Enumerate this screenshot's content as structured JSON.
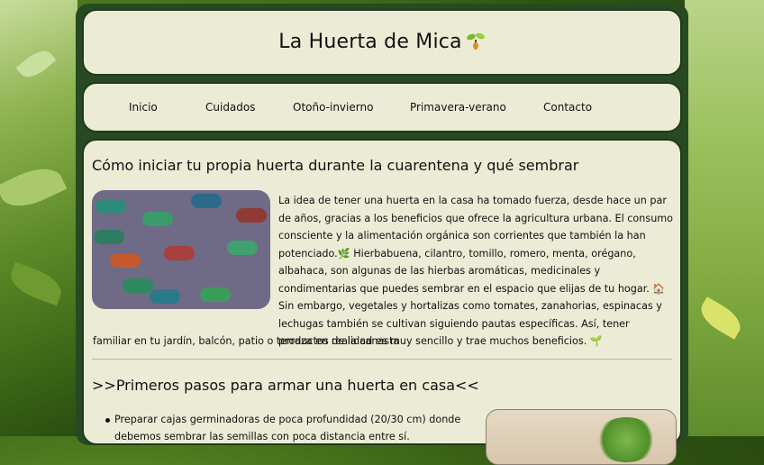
{
  "site": {
    "title": "La Huerta de Mica"
  },
  "nav": {
    "items": [
      "Inicio",
      "Cuidados",
      "Otoño-invierno",
      "Primavera-verano",
      "Contacto"
    ]
  },
  "post": {
    "title": "Cómo iniciar tu propia huerta durante la cuarentena y qué sembrar",
    "p1": "La idea de tener una huerta en la casa ha tomado fuerza, desde hace un par de años, gracias a los beneficios que ofrece la agricultura urbana. El consumo consciente y la alimentación orgánica son corrientes que también la han potenciado.🌿 Hierbabuena, cilantro, tomillo, romero, menta, orégano, albahaca, son algunas de las hierbas aromáticas, medicinales y condimentarias que puedes sembrar en el espacio que elijas de tu hogar. 🏠",
    "p2": "Sin embargo, vegetales y hortalizas como tomates, zanahorias, espinacas y lechugas también se cultivan siguiendo pautas específicas. Así, tener productos de la canasta",
    "p3": "familiar en tu jardín, balcón, patio o terraza en realidad es muy sencillo y trae muchos beneficios. 🌱",
    "section_title": ">>Primeros pasos para armar una huerta en casa<<",
    "list": [
      "Preparar cajas germinadoras de poca profundidad (20/30 cm) donde debemos sembrar las semillas con poca distancia entre sí."
    ]
  }
}
